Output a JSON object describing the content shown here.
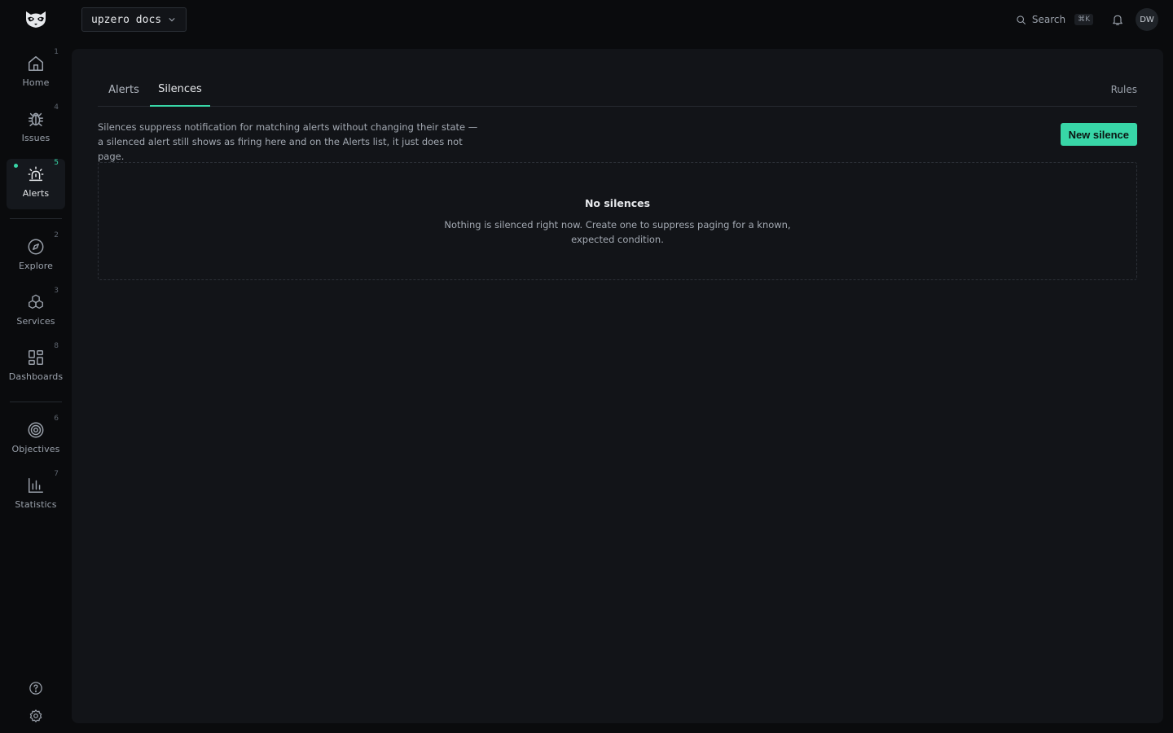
{
  "workspace": {
    "name": "upzero docs"
  },
  "header": {
    "search_label": "Search",
    "search_shortcut": "⌘K",
    "avatar_initials": "DW"
  },
  "sidebar": {
    "items": [
      {
        "label": "Home",
        "shortcut": "1",
        "icon": "home-icon"
      },
      {
        "label": "Issues",
        "shortcut": "4",
        "icon": "bug-icon"
      },
      {
        "label": "Alerts",
        "shortcut": "5",
        "icon": "siren-icon",
        "active": true
      },
      {
        "label": "Explore",
        "shortcut": "2",
        "icon": "compass-icon"
      },
      {
        "label": "Services",
        "shortcut": "3",
        "icon": "boxes-icon"
      },
      {
        "label": "Dashboards",
        "shortcut": "8",
        "icon": "grid-icon"
      },
      {
        "label": "Objectives",
        "shortcut": "6",
        "icon": "target-icon"
      },
      {
        "label": "Statistics",
        "shortcut": "7",
        "icon": "bar-chart-icon"
      }
    ]
  },
  "tabs": {
    "alerts": "Alerts",
    "silences": "Silences",
    "rules": "Rules"
  },
  "main": {
    "description": "Silences suppress notification for matching alerts without changing their state — a silenced alert still shows as firing here and on the Alerts list, it just does not page.",
    "new_button": "New silence",
    "empty_title": "No silences",
    "empty_text": "Nothing is silenced right now. Create one to suppress paging for a known, expected condition."
  },
  "colors": {
    "accent": "#38d6a7",
    "background": "#0a0b0d",
    "panel": "#121418"
  }
}
